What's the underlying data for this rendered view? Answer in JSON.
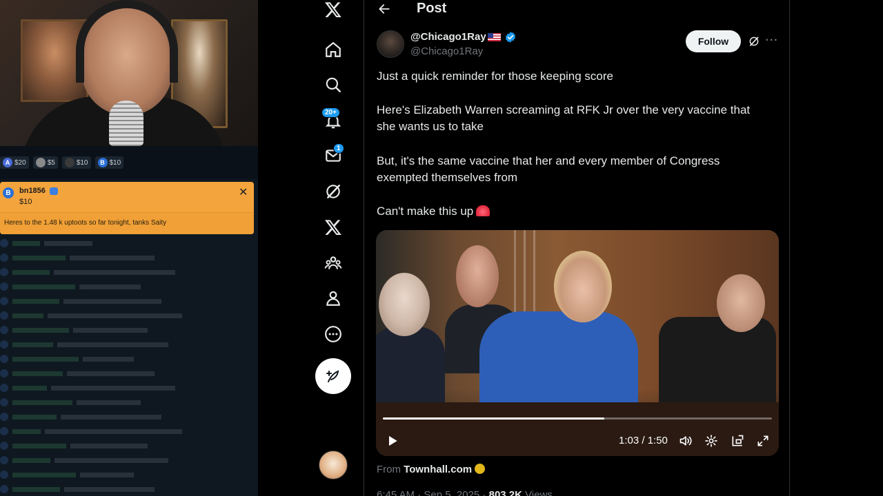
{
  "overlay": {
    "tips": [
      {
        "icon": "A",
        "amount": "$20",
        "color": "#4a6ad6"
      },
      {
        "icon": "",
        "amount": "$5",
        "color": "#8a8a8a"
      },
      {
        "icon": "",
        "amount": "$10",
        "color": "#3a3a3a"
      },
      {
        "icon": "B",
        "amount": "$10",
        "color": "#2a6fd6"
      }
    ],
    "alert": {
      "badge": "B",
      "username": "bn1856",
      "amount": "$10",
      "message": "Heres to the 1.48 k uptoots so far tonight, tanks Saity",
      "close": "✕",
      "color": "#f3a43c"
    }
  },
  "nav": {
    "notifications_badge": "20+",
    "messages_badge": "1",
    "accent": "#1d9bf0"
  },
  "post": {
    "header_title": "Post",
    "author_name": "@Chicago1Ray",
    "author_handle": "@Chicago1Ray",
    "follow_label": "Follow",
    "more_label": "···",
    "lines": [
      "Just a quick reminder for those keeping score",
      "Here's Elizabeth Warren screaming at RFK Jr over the very vaccine that",
      "she wants us to take",
      "But, it's the same vaccine that her and every member of Congress",
      "exempted themselves from",
      "Can't make this up"
    ],
    "video": {
      "time": "1:03 / 1:50",
      "progress": 0.57
    },
    "source_prefix": "From",
    "source_name": "Townhall.com",
    "timestamp_text": "6:45 AM · Sep 5, 2025 ·",
    "views_count": "803.2K",
    "views_label": "Views"
  }
}
